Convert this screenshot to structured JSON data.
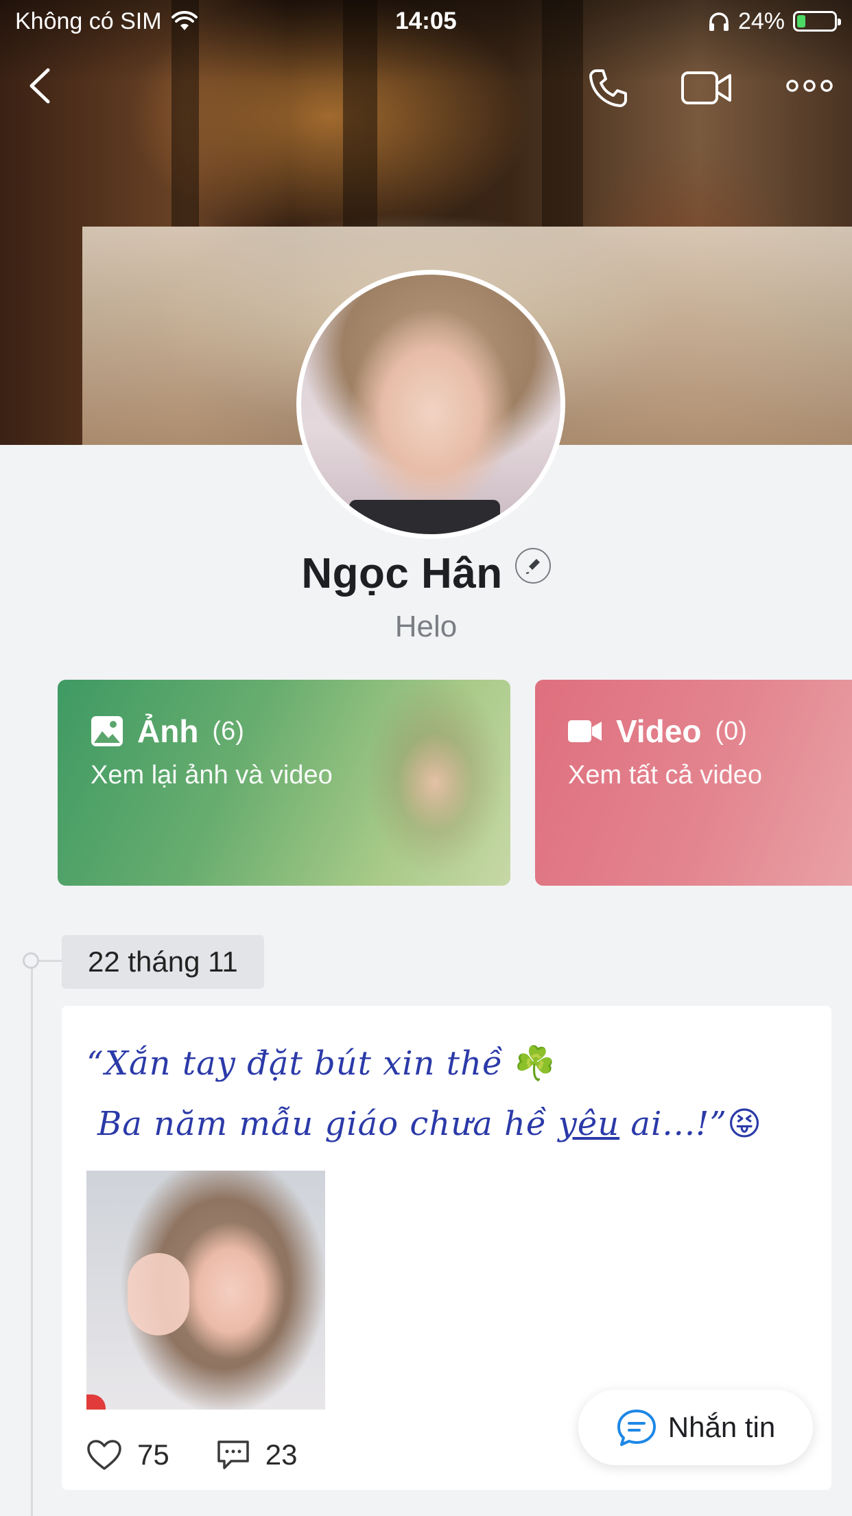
{
  "status_bar": {
    "carrier": "Không có SIM",
    "time": "14:05",
    "battery_percent": "24%",
    "battery_level": 0.24
  },
  "nav": {
    "icons": [
      "back-icon",
      "phone-icon",
      "video-call-icon",
      "more-icon"
    ]
  },
  "profile": {
    "name": "Ngọc Hân",
    "status": "Helo"
  },
  "media": {
    "photos": {
      "label": "Ảnh",
      "count": "(6)",
      "subtitle": "Xem lại ảnh và video",
      "icon": "image-icon"
    },
    "videos": {
      "label": "Video",
      "count": "(0)",
      "subtitle": "Xem tất cả video",
      "icon": "video-icon"
    }
  },
  "timeline": {
    "date": "22 tháng 11"
  },
  "post": {
    "line1": "“Xắn tay đặt bút xin thề ",
    "line1_emoji": "☘️",
    "line2_a": "Ba năm mẫu giáo chưa hề ",
    "line2_u": "yêu",
    "line2_b": " ai...!”",
    "line2_emoji": "😝",
    "likes": "75",
    "comments": "23"
  },
  "message_button": {
    "label": "Nhắn tin"
  },
  "colors": {
    "photos_card": "#3e9a63",
    "videos_card": "#df6f7e",
    "post_text": "#2b3aa8",
    "message_icon": "#1e88e5"
  }
}
